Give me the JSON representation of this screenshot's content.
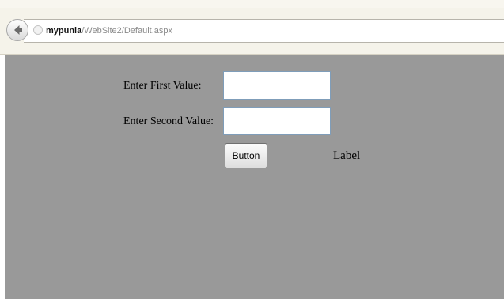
{
  "browser": {
    "url_host": "mypunia",
    "url_path": "/WebSite2/Default.aspx",
    "back_icon": "back-arrow-icon",
    "site_icon": "page-icon"
  },
  "form": {
    "first_value_label": "Enter First Value:",
    "second_value_label": "Enter Second Value:",
    "first_value": "",
    "second_value": "",
    "button_label": "Button",
    "result_label": "Label"
  },
  "colors": {
    "page_background": "#999999",
    "toolbar_background": "#f5f3ea",
    "input_border": "#7f9db9"
  }
}
